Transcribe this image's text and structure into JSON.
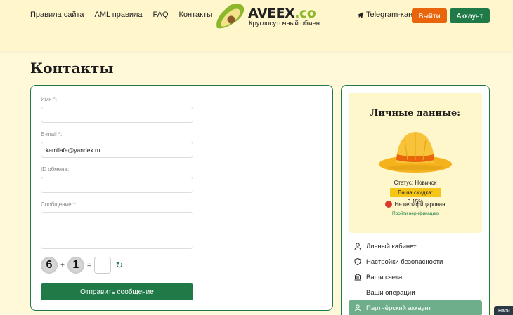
{
  "header": {
    "nav": [
      "Правила сайта",
      "AML правила",
      "FAQ",
      "Контакты"
    ],
    "logo_main": "AVEEX",
    "logo_suffix": ".co",
    "logo_sub": "Круглосуточный обмен",
    "telegram": "Telegram-канал",
    "login_button": "Выйти",
    "account_button": "Аккаунт"
  },
  "page": {
    "title": "Контакты"
  },
  "form": {
    "name_label": "Имя *:",
    "name_value": "",
    "email_label": "E-mail *:",
    "email_value": "kamilafe@yandex.ru",
    "exchange_id_label": "ID обмена:",
    "exchange_id_value": "",
    "message_label": "Сообщение *:",
    "captcha_a": "6",
    "captcha_op": "+",
    "captcha_b": "1",
    "captcha_eq": "=",
    "submit_label": "Отправить сообщение"
  },
  "profile": {
    "title": "Личные данные:",
    "status": "Статус: Новичок",
    "discount": "Ваша скидка: 0.15%",
    "verification": "Не верифицирован",
    "verify_link": "Пройти верификацию"
  },
  "menu": [
    {
      "label": "Личный кабинет",
      "icon": "user-icon"
    },
    {
      "label": "Настройки безопасности",
      "icon": "shield-icon"
    },
    {
      "label": "Ваши счета",
      "icon": "bank-icon"
    },
    {
      "label": "Ваши операции",
      "icon": ""
    },
    {
      "label": "Партнёрский аккаунт",
      "icon": "user-icon"
    }
  ],
  "chat_label": "Напи",
  "colors": {
    "brand_green": "#1f7a48",
    "accent_orange": "#e8650c",
    "background": "#fff9d9"
  }
}
